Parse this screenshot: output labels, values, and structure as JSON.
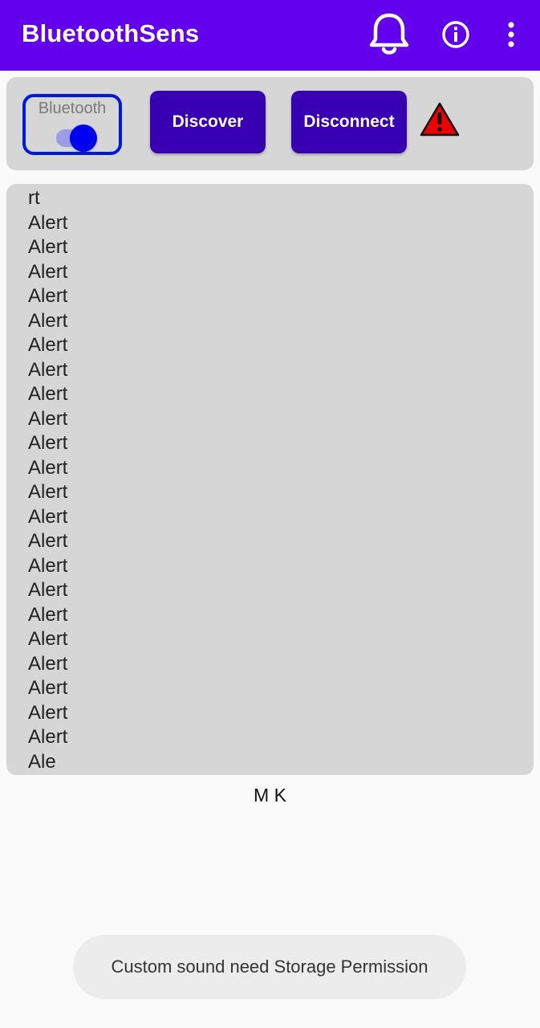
{
  "app_bar": {
    "title": "BluetoothSens",
    "color": "#6200ee",
    "actions": [
      "bell-icon",
      "info-icon",
      "more-vert-icon"
    ]
  },
  "controls": {
    "bluetooth_label": "Bluetooth",
    "bluetooth_on": true,
    "discover_label": "Discover",
    "disconnect_label": "Disconnect",
    "status_icon": "warning-icon",
    "button_color": "#3700b3"
  },
  "log": {
    "lines": [
      "rt",
      "Alert",
      "Alert",
      "Alert",
      "Alert",
      "Alert",
      "Alert",
      "Alert",
      "Alert",
      "Alert",
      "Alert",
      "Alert",
      "Alert",
      "Alert",
      "Alert",
      "Alert",
      "Alert",
      "Alert",
      "Alert",
      "Alert",
      "Alert",
      "Alert",
      "Alert",
      "Ale"
    ]
  },
  "footer": {
    "initials": "M K"
  },
  "toast": {
    "message": "Custom sound need Storage Permission"
  }
}
